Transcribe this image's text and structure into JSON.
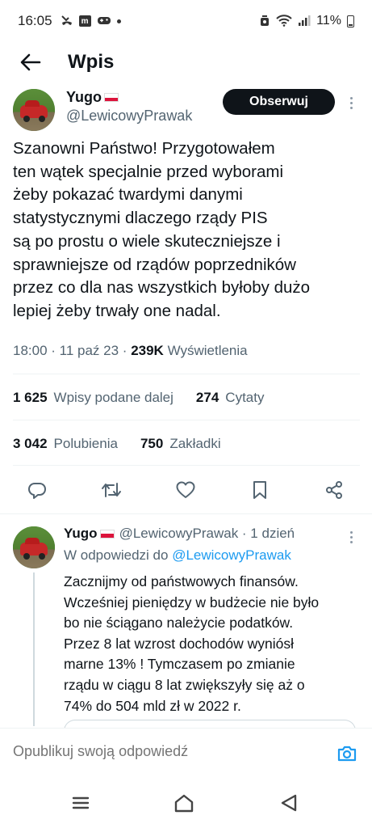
{
  "status_bar": {
    "time": "16:05",
    "battery": "11%"
  },
  "header": {
    "title": "Wpis"
  },
  "tweet": {
    "display_name": "Yugo",
    "handle": "@LewicowyPrawak",
    "follow_label": "Obserwuj",
    "text": "Szanowni Państwo! Przygotowałem\nten wątek specjalnie przed wyborami\nżeby pokazać twardymi danymi\nstatystycznymi dlaczego rządy PIS\nsą po prostu o wiele skuteczniejsze i\nsprawniejsze od rządów poprzedników\nprzez co dla nas wszystkich byłoby dużo\nlepiej żeby trwały one nadal.",
    "time": "18:00 · 11 paź 23 ·",
    "views_count": "239K",
    "views_label": "Wyświetlenia",
    "stats": {
      "reposts_count": "1 625",
      "reposts_label": "Wpisy podane dalej",
      "quotes_count": "274",
      "quotes_label": "Cytaty",
      "likes_count": "3 042",
      "likes_label": "Polubienia",
      "bookmarks_count": "750",
      "bookmarks_label": "Zakładki"
    }
  },
  "reply": {
    "display_name": "Yugo",
    "meta": "@LewicowyPrawak · 1 dzień",
    "reply_to_prefix": "W odpowiedzi do",
    "reply_to_handle": "@LewicowyPrawak",
    "text": "Zacznijmy od państwowych finansów.\nWcześniej pieniędzy w budżecie nie było\nbo nie ściągano należycie podatków.\nPrzez 8 lat wzrost dochodów wyniósł\nmarne 13% ! Tymczasem po zmianie\nrządu w ciągu 8 lat zwiększyły się aż o\n74% do 504 mld zł w 2022 r."
  },
  "compose": {
    "placeholder": "Opublikuj swoją odpowiedź"
  },
  "colors": {
    "accent": "#1d9bf0",
    "text_secondary": "#536471",
    "follow_bg": "#0f1419"
  }
}
